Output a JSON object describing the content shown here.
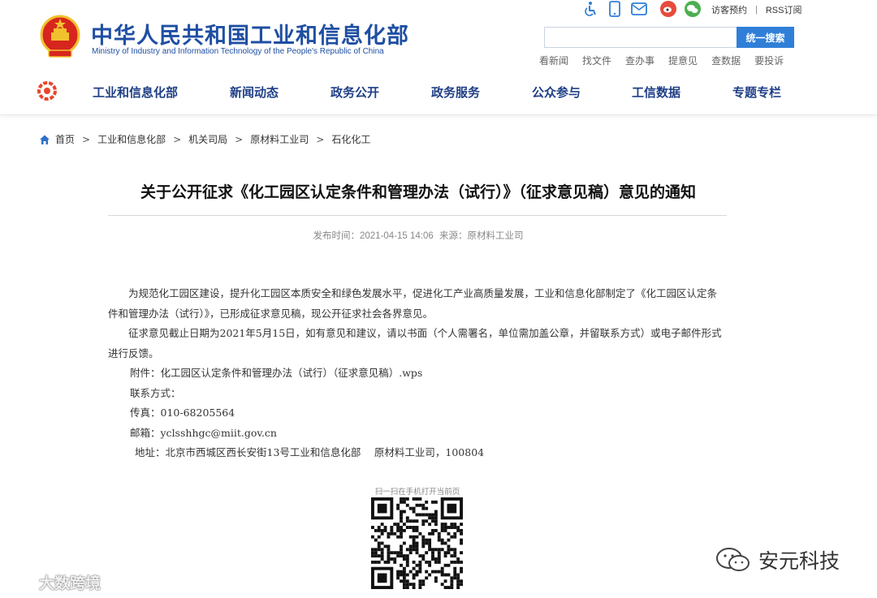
{
  "header": {
    "title": "中华人民共和国工业和信息化部",
    "subtitle": "Ministry of Industry and Information Technology of the People's Republic of China",
    "top_links": [
      "访客预约",
      "RSS订阅"
    ],
    "top_links_separator": "|",
    "top_icons": [
      "accessibility-icon",
      "mobile-icon",
      "mail-icon",
      "weibo-icon",
      "wechat-icon"
    ],
    "search_button": "统一搜索",
    "search_value": "",
    "quick_links": [
      "看新闻",
      "找文件",
      "查办事",
      "提意见",
      "查数据",
      "要投诉"
    ]
  },
  "nav": {
    "items": [
      "工业和信息化部",
      "新闻动态",
      "政务公开",
      "政务服务",
      "公众参与",
      "工信数据",
      "专题专栏"
    ]
  },
  "breadcrumb": {
    "items": [
      "首页",
      "工业和信息化部",
      "机关司局",
      "原材料工业司",
      "石化化工"
    ],
    "separator": ">"
  },
  "article": {
    "title": "关于公开征求《化工园区认定条件和管理办法（试行）》（征求意见稿）意见的通知",
    "publish_time": "发布时间：2021-04-15 14:06",
    "source": "来源：原材料工业司",
    "paragraphs": [
      "为规范化工园区建设，提升化工园区本质安全和绿色发展水平，促进化工产业高质量发展，工业和信息化部制定了《化工园区认定条件和管理办法（试行）》，已形成征求意见稿，现公开征求社会各界意见。",
      "征求意见截止日期为2021年5月15日，如有意见和建议，请以书面（个人需署名，单位需加盖公章，并留联系方式）或电子邮件形式进行反馈。"
    ],
    "attachment": "附件：化工园区认定条件和管理办法（试行）（征求意见稿）.wps",
    "contact_label": "联系方式：",
    "fax": "传真：010-68205564",
    "email": "邮箱：yclsshhgc@miit.gov.cn",
    "address": "地址：北京市西城区西长安街13号工业和信息化部　 原材料工业司，100804"
  },
  "qr": {
    "caption": "扫一扫在手机打开当前页"
  },
  "watermarks": {
    "left": "大数跨境",
    "right": "安元科技"
  },
  "colors": {
    "brand_blue": "#1f4fa3",
    "nav_blue": "#1f3f86",
    "search_button": "#2f7fd8",
    "emblem_red": "#d7261e",
    "emblem_gold": "#f2c12e"
  }
}
